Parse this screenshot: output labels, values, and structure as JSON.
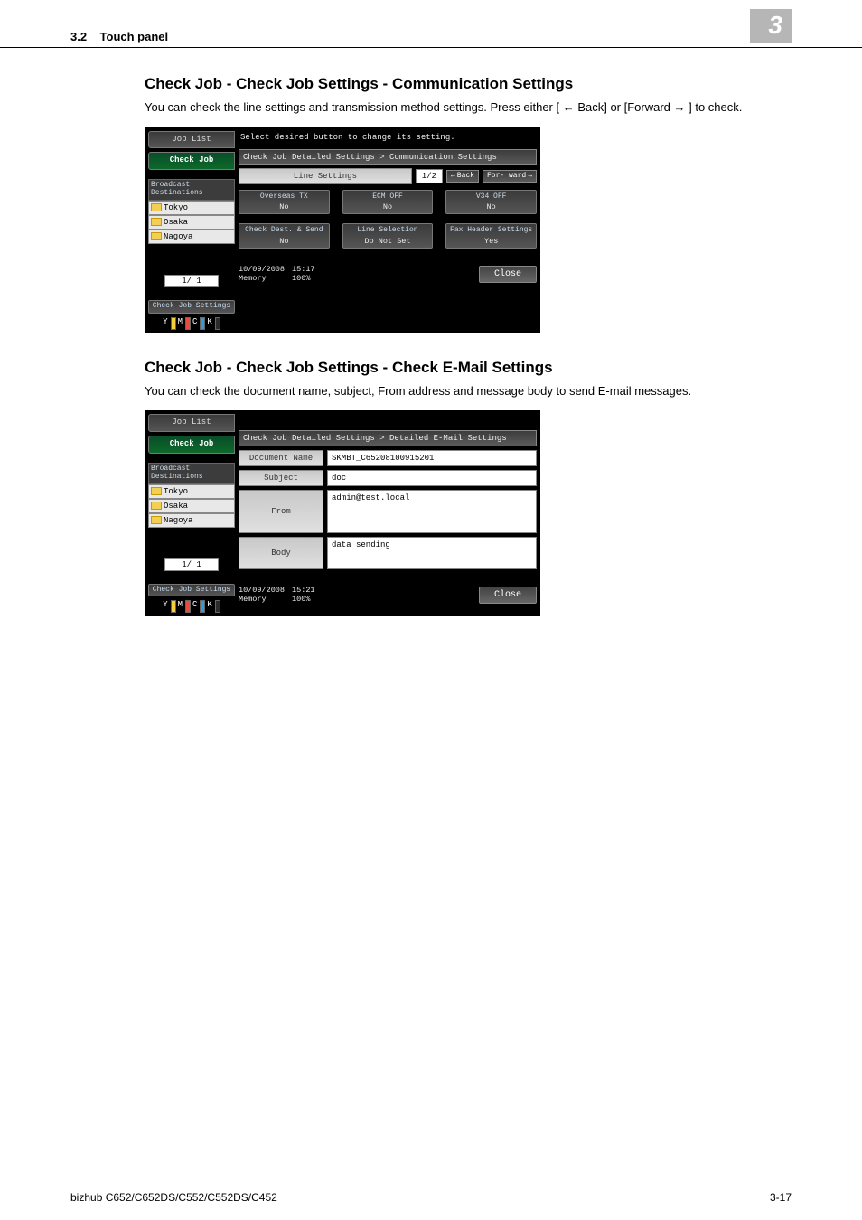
{
  "header": {
    "section_number": "3.2",
    "section_label": "Touch panel",
    "chapter_number": "3"
  },
  "section1": {
    "title": "Check Job - Check Job Settings - Communication Settings",
    "body": "You can check the line settings and transmission method settings. Press either [ ← Back] or [Forward → ] to check."
  },
  "section2": {
    "title": "Check Job - Check Job Settings - Check E-Mail Settings",
    "body": "You can check the document name, subject, From address and message body to send E-mail messages."
  },
  "panel1": {
    "tabs": {
      "job_list": "Job List",
      "check_job": "Check Job"
    },
    "instruction": "Select desired button to change its setting.",
    "breadcrumb": "Check Job Detailed Settings > Communication Settings",
    "line_settings_label": "Line Settings",
    "page": "1/2",
    "back": "Back",
    "forward": "For- ward",
    "side_header": "Broadcast Destinations",
    "destinations": [
      "Tokyo",
      "Osaka",
      "Nagoya"
    ],
    "side_page": "1/   1",
    "side_btn": "Check Job Settings",
    "settings": [
      {
        "header": "Overseas TX",
        "value": "No"
      },
      {
        "header": "ECM OFF",
        "value": "No"
      },
      {
        "header": "V34 OFF",
        "value": "No"
      },
      {
        "header": "Check Dest. & Send",
        "value": "No"
      },
      {
        "header": "Line Selection",
        "value": "Do Not Set"
      },
      {
        "header": "Fax Header Settings",
        "value": "Yes"
      }
    ],
    "timestamp": {
      "date": "10/09/2008",
      "time": "15:17",
      "mem_label": "Memory",
      "mem_value": "100%"
    },
    "close": "Close"
  },
  "panel2": {
    "tabs": {
      "job_list": "Job List",
      "check_job": "Check Job"
    },
    "breadcrumb": "Check Job Detailed Settings > Detailed E-Mail Settings",
    "side_header": "Broadcast Destinations",
    "destinations": [
      "Tokyo",
      "Osaka",
      "Nagoya"
    ],
    "side_page": "1/   1",
    "side_btn": "Check Job Settings",
    "doc_label": "Document Name",
    "doc_value": "SKMBT_C65208100915201",
    "subj_label": "Subject",
    "subj_value": "doc",
    "from_label": "From",
    "from_value": "admin@test.local",
    "body_label": "Body",
    "body_value": "data sending",
    "timestamp": {
      "date": "10/09/2008",
      "time": "15:21",
      "mem_label": "Memory",
      "mem_value": "100%"
    },
    "close": "Close"
  },
  "footer": {
    "model": "bizhub C652/C652DS/C552/C552DS/C452",
    "page": "3-17"
  },
  "toner_letters": [
    "Y",
    "M",
    "C",
    "K"
  ],
  "toner_colors": [
    "#f4d03f",
    "#e74c3c",
    "#3498db",
    "#2c2c2c"
  ]
}
